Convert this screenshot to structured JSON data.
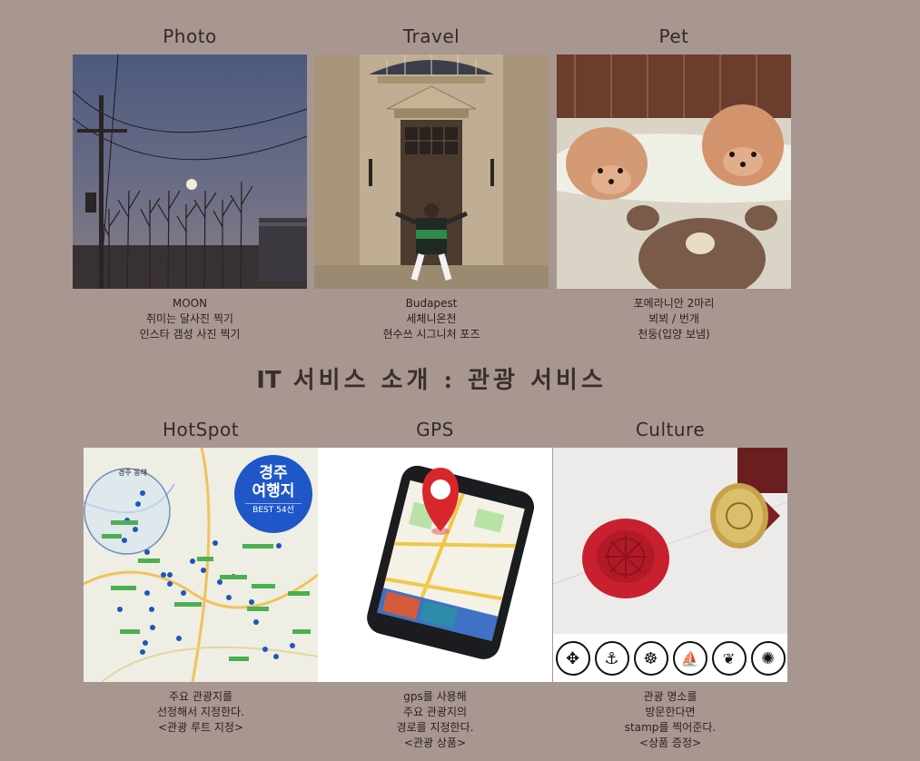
{
  "hobbies": [
    {
      "title": "Photo",
      "lines": [
        "MOON",
        "취미는 달사진 찍기",
        "인스타 갬성 사진 찍기"
      ]
    },
    {
      "title": "Travel",
      "lines": [
        "Budapest",
        "세체니온천",
        "현수쓰 시그니처 포즈"
      ]
    },
    {
      "title": "Pet",
      "lines": [
        "포메라니안 2마리",
        "뵈뵈 / 번개",
        "천둥(입양 보냄)"
      ]
    }
  ],
  "section": {
    "prefix": "IT",
    "title": "서비스 소개 : 관광 서비스"
  },
  "services": [
    {
      "title": "HotSpot",
      "lines": [
        "주요 관광지를",
        "선정해서 지정한다.",
        "<관광 루트 지정>"
      ],
      "map_badge": {
        "line1": "경주",
        "line2": "여행지",
        "line3": "BEST 54선"
      },
      "map_label": "경주 동해"
    },
    {
      "title": "GPS",
      "lines": [
        "gps를 사용해",
        "주요 관광지의",
        "경로를 지정한다.",
        "<관광 상품>"
      ]
    },
    {
      "title": "Culture",
      "lines": [
        "관광 명소를",
        "방문한다면",
        "stamp를 찍어준다.",
        "<상품 증정>"
      ]
    }
  ],
  "colors": {
    "background": "#a89790",
    "badge_blue": "#1f57c9",
    "wax_red": "#c8202e",
    "pin_red": "#d8262c"
  }
}
